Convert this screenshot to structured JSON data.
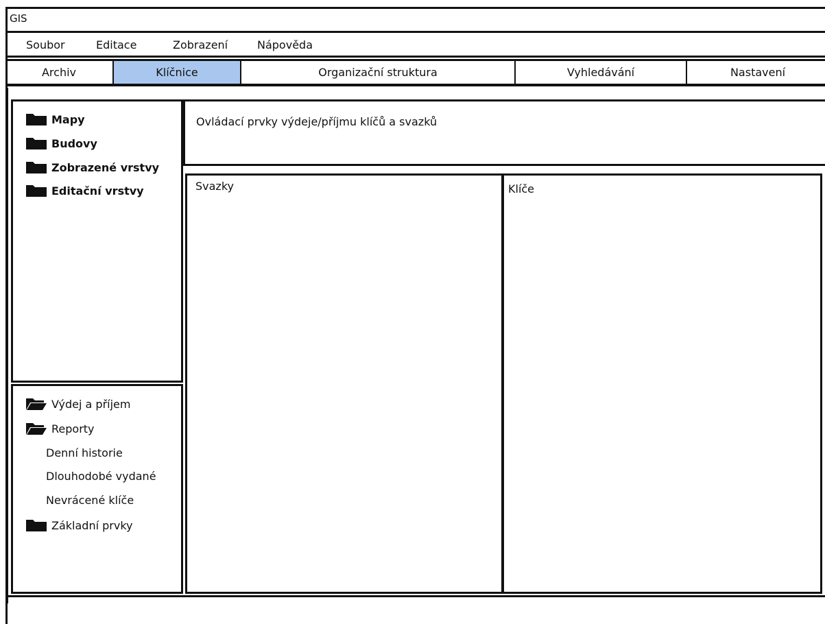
{
  "window": {
    "title": "GIS"
  },
  "menu": {
    "items": [
      {
        "label": "Soubor"
      },
      {
        "label": "Editace"
      },
      {
        "label": "Zobrazení"
      },
      {
        "label": "Nápověda"
      }
    ]
  },
  "tabs": [
    {
      "label": "Archiv",
      "active": false
    },
    {
      "label": "Klíčnice",
      "active": true
    },
    {
      "label": "Organizační struktura",
      "active": false
    },
    {
      "label": "Vyhledávání",
      "active": false
    },
    {
      "label": "Nastavení",
      "active": false
    }
  ],
  "left_top": {
    "items": [
      {
        "label": "Mapy",
        "icon": "folder-closed-icon"
      },
      {
        "label": "Budovy",
        "icon": "folder-closed-icon"
      },
      {
        "label": "Zobrazené vrstvy",
        "icon": "folder-closed-icon"
      },
      {
        "label": "Editační vrstvy",
        "icon": "folder-closed-icon"
      }
    ]
  },
  "left_bottom": {
    "items": [
      {
        "label": "Výdej a příjem",
        "icon": "folder-open-icon"
      },
      {
        "label": "Reporty",
        "icon": "folder-open-icon"
      },
      {
        "label": "Základní prvky",
        "icon": "folder-closed-icon"
      }
    ],
    "report_children": [
      {
        "label": "Denní historie"
      },
      {
        "label": "Dlouhodobé vydané"
      },
      {
        "label": "Nevrácené klíče"
      }
    ]
  },
  "controls_panel": {
    "label": "Ovládací prvky výdeje/příjmu klíčů a svazků"
  },
  "bundles_panel": {
    "label": "Svazky"
  },
  "keys_panel": {
    "label": "Klíče"
  },
  "colors": {
    "active_tab": "#a9c7ee",
    "border": "#111111"
  }
}
